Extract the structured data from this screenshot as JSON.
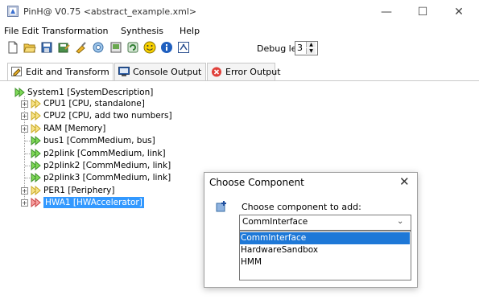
{
  "window": {
    "title": "PinH@ V0.75 <abstract_example.xml>",
    "minimize_glyph": "—",
    "maximize_glyph": "☐",
    "close_glyph": "✕"
  },
  "menu": [
    "File",
    "Edit",
    "Transformation",
    "Synthesis",
    "Help"
  ],
  "toolbar": {
    "icons": [
      "new-file-icon",
      "open-folder-icon",
      "save-icon",
      "save-as-icon",
      "clean-icon",
      "settings-icon",
      "export-icon",
      "refresh-icon",
      "smiley-icon",
      "info-icon",
      "run-icon"
    ],
    "debug_label": "Debug level:",
    "debug_value": "3"
  },
  "tabs": [
    {
      "label": "Edit and Transform",
      "icon": "edit-icon",
      "active": true
    },
    {
      "label": "Console Output",
      "icon": "console-icon",
      "active": false
    },
    {
      "label": "Error Output",
      "icon": "error-icon",
      "active": false
    }
  ],
  "tree": {
    "root": "System1 [SystemDescription]",
    "nodes": [
      {
        "label": "CPU1 [CPU, standalone]",
        "expandable": true,
        "icon": "yellow"
      },
      {
        "label": "CPU2 [CPU, add two numbers]",
        "expandable": true,
        "icon": "yellow"
      },
      {
        "label": "RAM [Memory]",
        "expandable": true,
        "icon": "yellow"
      },
      {
        "label": "bus1 [CommMedium, bus]",
        "expandable": false,
        "icon": "green"
      },
      {
        "label": "p2plink [CommMedium, link]",
        "expandable": false,
        "icon": "green"
      },
      {
        "label": "p2plink2 [CommMedium, link]",
        "expandable": false,
        "icon": "green"
      },
      {
        "label": "p2plink3 [CommMedium, link]",
        "expandable": false,
        "icon": "green"
      },
      {
        "label": "PER1 [Periphery]",
        "expandable": true,
        "icon": "yellow"
      },
      {
        "label": "HWA1 [HWAccelerator]",
        "expandable": true,
        "icon": "red",
        "selected": true
      }
    ]
  },
  "dialog": {
    "title": "Choose Component",
    "close_glyph": "✕",
    "prompt": "Choose component to add:",
    "selected": "CommInterface",
    "options": [
      "CommInterface",
      "HardwareSandbox",
      "HMM"
    ]
  },
  "colors": {
    "selection": "#3399ff",
    "dropdown_selection": "#1e78d7",
    "green_arrow": "#7ed957",
    "yellow_arrow": "#f7e38a",
    "red_arrow": "#f08a8a"
  }
}
